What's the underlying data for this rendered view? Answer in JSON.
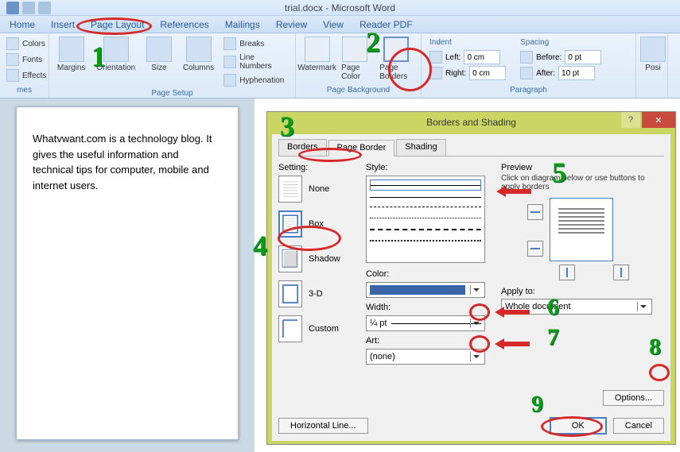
{
  "window_title": "trial.docx - Microsoft Word",
  "tabs": {
    "home": "Home",
    "insert": "Insert",
    "pagelayout": "Page Layout",
    "references": "References",
    "mailings": "Mailings",
    "review": "Review",
    "view": "View",
    "reader": "Reader PDF"
  },
  "themes_group": {
    "label": "mes",
    "colors": "Colors",
    "fonts": "Fonts",
    "effects": "Effects"
  },
  "pagesetup_group": {
    "label": "Page Setup",
    "margins": "Margins",
    "orientation": "Orientation",
    "size": "Size",
    "columns": "Columns",
    "breaks": "Breaks",
    "linenumbers": "Line Numbers",
    "hyphenation": "Hyphenation"
  },
  "pagebg_group": {
    "label": "Page Background",
    "watermark": "Watermark",
    "pagecolor": "Page Color",
    "pageborders": "Page Borders"
  },
  "para_group": {
    "label": "Paragraph",
    "indent": "Indent",
    "left": "Left:",
    "right": "Right:",
    "left_val": "0 cm",
    "right_val": "0 cm",
    "spacing": "Spacing",
    "before": "Before:",
    "after": "After:",
    "before_val": "0 pt",
    "after_val": "10 pt"
  },
  "arrange_label": "Posi",
  "doc_text": "Whatvwant.com is a technology blog. It gives the useful information and technical tips for computer, mobile and internet users.",
  "dialog": {
    "title": "Borders and Shading",
    "tabs": {
      "borders": "Borders",
      "pageborder": "Page Border",
      "shading": "Shading"
    },
    "setting_label": "Setting:",
    "settings": {
      "none": "None",
      "box": "Box",
      "shadow": "Shadow",
      "threed": "3-D",
      "custom": "Custom"
    },
    "style_label": "Style:",
    "color_label": "Color:",
    "width_label": "Width:",
    "width_val": "¼ pt",
    "art_label": "Art:",
    "art_val": "(none)",
    "preview_label": "Preview",
    "preview_hint": "Click on diagram below or use buttons to apply borders",
    "apply_label": "Apply to:",
    "apply_val": "Whole document",
    "options_btn": "Options...",
    "hline_btn": "Horizontal Line...",
    "ok": "OK",
    "cancel": "Cancel"
  },
  "annotations": {
    "1": "1",
    "2": "2",
    "3": "3",
    "4": "4",
    "5": "5",
    "6": "6",
    "7": "7",
    "8": "8",
    "9": "9"
  }
}
